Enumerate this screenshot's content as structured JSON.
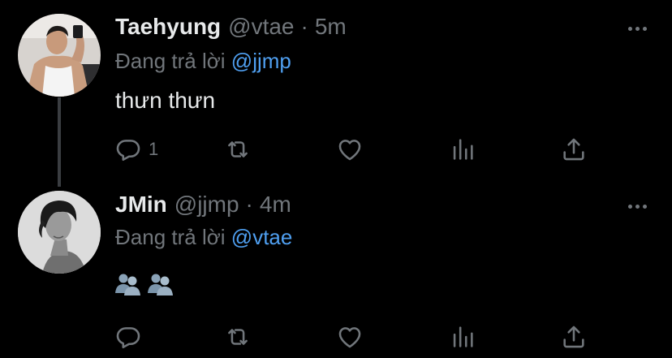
{
  "tweets": [
    {
      "name": "Taehyung",
      "handle": "@vtae",
      "separator": "·",
      "time": "5m",
      "reply_prefix": "Đang trả lời",
      "reply_to": "@jjmp",
      "text": "thưn thưn",
      "reply_count": "1",
      "avatar": "shirtless-mirror-selfie-avatar"
    },
    {
      "name": "JMin",
      "handle": "@jjmp",
      "separator": "·",
      "time": "4m",
      "reply_prefix": "Đang trả lời",
      "reply_to": "@vtae",
      "emojis": [
        "busts-in-silhouette",
        "busts-in-silhouette"
      ],
      "reply_count": "",
      "avatar": "black-and-white-portrait-avatar"
    }
  ],
  "colors": {
    "background": "#000000",
    "text": "#e7e9ea",
    "muted": "#71767b",
    "mention": "#4f9ff0",
    "thread_line": "#3a3d41"
  },
  "icons": [
    "reply-icon",
    "retweet-icon",
    "like-icon",
    "stats-icon",
    "share-icon",
    "more-icon"
  ]
}
